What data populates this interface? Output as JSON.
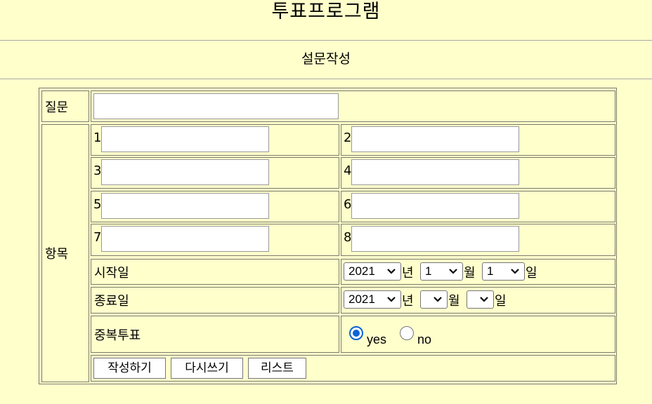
{
  "header": {
    "title": "투표프로그램",
    "subtitle": "설문작성"
  },
  "form": {
    "question_label": "질문",
    "question_value": "",
    "items_label": "항목",
    "items": [
      {
        "num": "1",
        "value": ""
      },
      {
        "num": "2",
        "value": ""
      },
      {
        "num": "3",
        "value": ""
      },
      {
        "num": "4",
        "value": ""
      },
      {
        "num": "5",
        "value": ""
      },
      {
        "num": "6",
        "value": ""
      },
      {
        "num": "7",
        "value": ""
      },
      {
        "num": "8",
        "value": ""
      }
    ],
    "start": {
      "label": "시작일",
      "year": "2021",
      "year_unit": "년",
      "month": "1",
      "month_unit": "월",
      "day": "1",
      "day_unit": "일"
    },
    "end": {
      "label": "종료일",
      "year": "2021",
      "year_unit": "년",
      "month": "",
      "month_unit": "월",
      "day": "",
      "day_unit": "일"
    },
    "multi": {
      "label": "중복투표",
      "yes_label": "yes",
      "no_label": "no",
      "selected": "yes"
    },
    "buttons": {
      "submit": "작성하기",
      "reset": "다시쓰기",
      "list": "리스트"
    }
  },
  "colors": {
    "background": "#ffffcc",
    "accent": "#0b63d6"
  },
  "icons": {
    "select_arrow": "chevron-down-icon"
  }
}
